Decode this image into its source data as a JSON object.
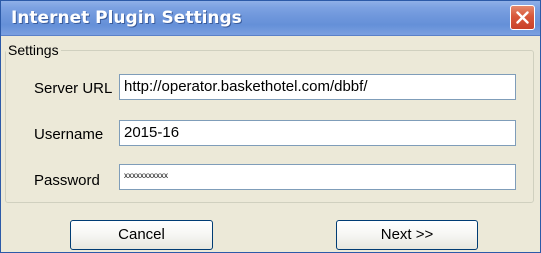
{
  "window": {
    "title": "Internet Plugin Settings"
  },
  "settings_group": {
    "legend": "Settings",
    "fields": [
      {
        "label": "Server URL",
        "value": "http://operator.baskethotel.com/dbbf/"
      },
      {
        "label": "Username",
        "value": "2015-16"
      },
      {
        "label": "Password",
        "value": "xxxxxxxxxxx"
      }
    ]
  },
  "buttons": {
    "cancel": "Cancel",
    "next": "Next >>"
  },
  "colors": {
    "titlebar": "#6f97dc",
    "close_button": "#d8573a",
    "dialog_background": "#ece9d8",
    "input_border": "#7f9db9"
  },
  "icons": {
    "close": "close-x-icon"
  }
}
